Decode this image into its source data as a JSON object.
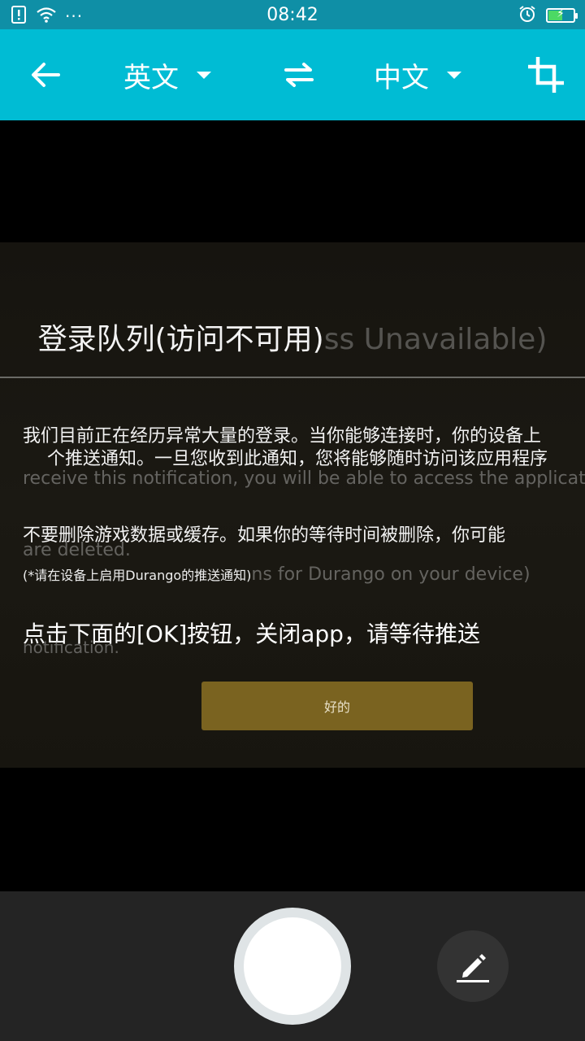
{
  "status_bar": {
    "time": "08:42",
    "dots": "···",
    "battery_level": 0.55
  },
  "toolbar": {
    "source_lang": "英文",
    "target_lang": "中文",
    "accent_color": "#00bcd4"
  },
  "preview": {
    "title_overlay": "登录队列(访问不可用)",
    "title_original": "ss Unavailable)",
    "line1_overlay": "我们目前正在经历异常大量的登录。当你能够连接时，你的设备上",
    "line2_overlay": "个推送通知。一旦您收到此通知，您将能够随时访问该应用程序",
    "line3_original": "receive this notification, you will be able to access the application at ar",
    "line4_overlay": "不要删除游戏数据或缓存。如果你的等待时间被删除，你可能",
    "line5_original": "are deleted.",
    "line6_overlay": "(*请在设备上启用Durango的推送通知)",
    "line6_original": "ns for Durango on your device)",
    "line7_overlay": "点击下面的[OK]按钮，关闭app，请等待推送",
    "line8_original": "notification.",
    "ok_button_label": "好的"
  },
  "bottom_bar": {
    "shutter_label": "",
    "edit_label": ""
  }
}
